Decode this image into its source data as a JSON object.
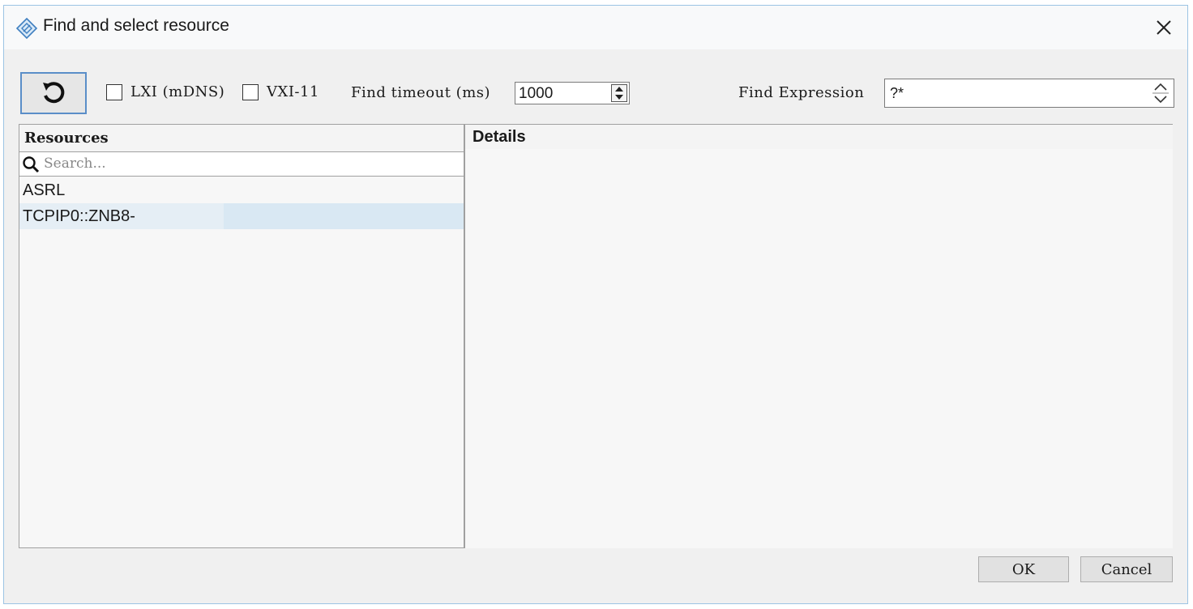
{
  "window": {
    "title": "Find and select resource"
  },
  "toolbar": {
    "lxi_label": "LXI (mDNS)",
    "vxi_label": "VXI-11",
    "timeout_label": "Find timeout (ms)",
    "timeout_value": "1000",
    "expression_label": "Find Expression",
    "expression_value": "?*"
  },
  "resources": {
    "header": "Resources",
    "search_placeholder": "Search...",
    "items": [
      {
        "label": "ASRL"
      },
      {
        "label": "TCPIP0::ZNB8-"
      }
    ]
  },
  "details": {
    "header": "Details"
  },
  "footer": {
    "ok_label": "OK",
    "cancel_label": "Cancel"
  },
  "colors": {
    "accent": "#5a8ec8",
    "selection": "#d9e8f3",
    "window_border": "#9cc4e4"
  }
}
